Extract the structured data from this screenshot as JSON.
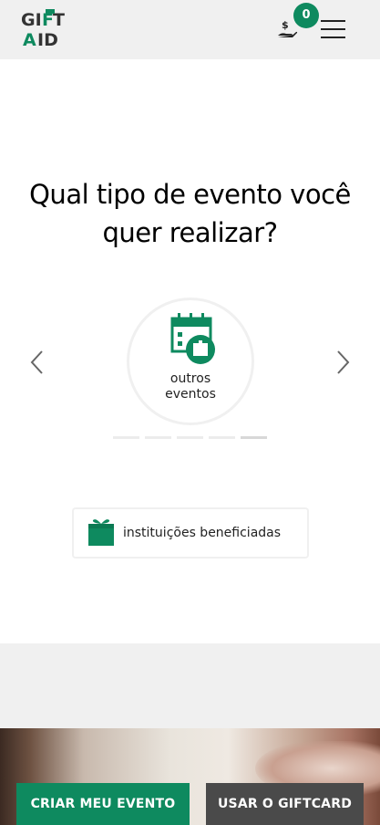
{
  "header": {
    "logo": {
      "top": "GIFT",
      "bottom": "AID"
    },
    "donation_count": "0",
    "brand_color": "#0e8a5f"
  },
  "main": {
    "question": "Qual tipo de evento você quer realizar?",
    "carousel": {
      "current_event": {
        "label": "outros eventos",
        "icon": "calendar-gift-icon"
      },
      "slide_count": 5,
      "active_slide": 5
    },
    "institutions_button": {
      "label": "instituições beneficiadas",
      "icon": "gift-icon"
    }
  },
  "footer": {
    "create_event_label": "CRIAR MEU EVENTO",
    "use_giftcard_label": "USAR O GIFTCARD"
  }
}
